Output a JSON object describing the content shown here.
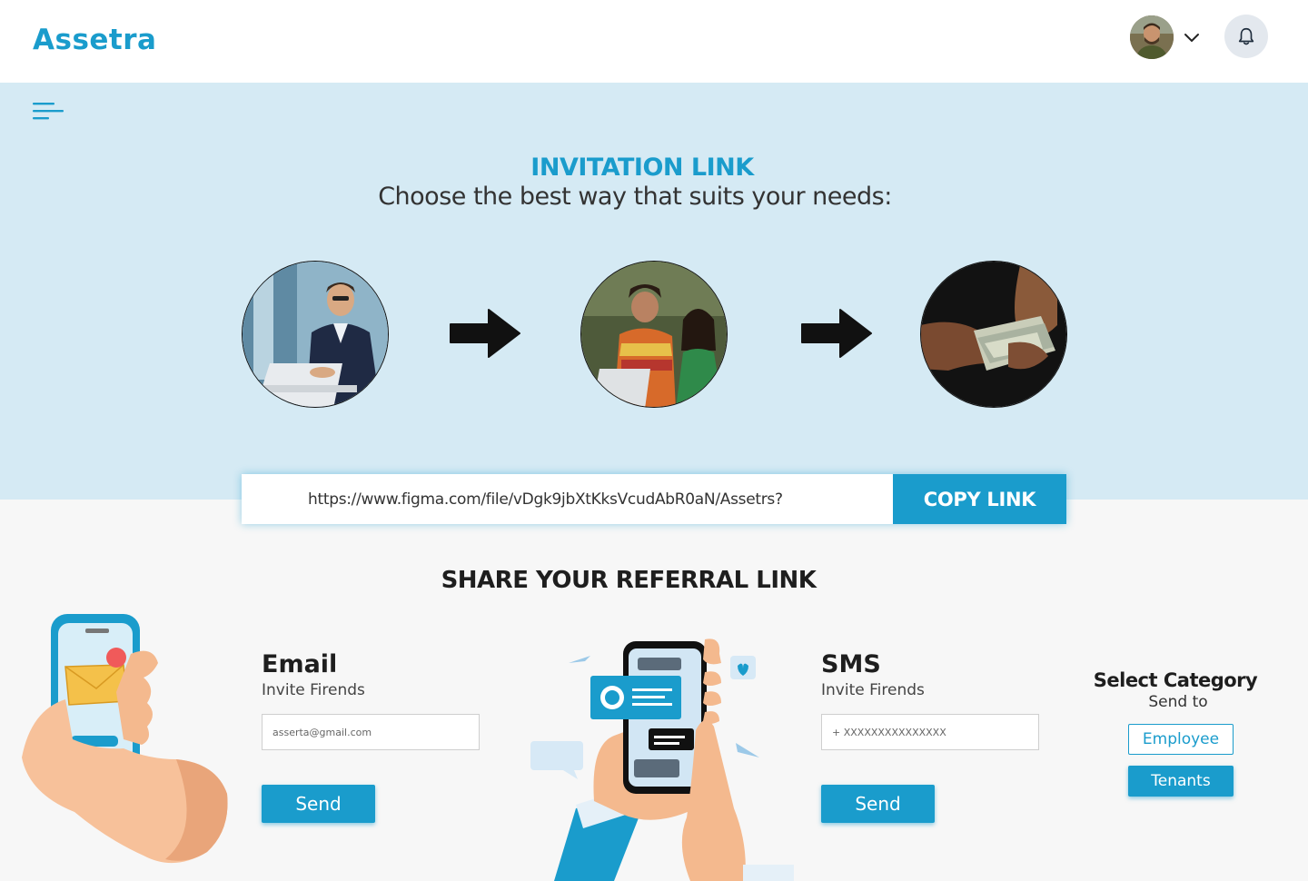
{
  "app": {
    "logo": "Assetra"
  },
  "header": {
    "avatar": "avatar",
    "dropdown_icon": "chevron-down-icon",
    "notification_icon": "bell-icon"
  },
  "hero": {
    "menu_icon": "menu-icon",
    "title": "INVITATION LINK",
    "subtitle": "Choose the best way that suits your needs:",
    "steps": [
      "man-working-on-laptop",
      "women-at-laptop",
      "hands-holding-cash"
    ],
    "step_arrow_icon": "arrow-right-icon"
  },
  "link": {
    "url": "https://www.figma.com/file/vDgk9jbXtKksVcudAbR0aN/Assetrs?",
    "copy_label": "COPY LINK"
  },
  "share": {
    "title": "SHARE YOUR REFERRAL LINK",
    "email": {
      "title": "Email",
      "subtitle": "Invite Firends",
      "placeholder": "asserta@gmail.com",
      "send_label": "Send"
    },
    "sms": {
      "title": "SMS",
      "subtitle": "Invite Firends",
      "placeholder": "+ XXXXXXXXXXXXXXX",
      "send_label": "Send"
    },
    "category": {
      "title": "Select Category",
      "subtitle": "Send to",
      "options": [
        "Employee",
        "Tenants"
      ],
      "selected": "Tenants"
    }
  },
  "colors": {
    "brand": "#1a9ccc",
    "hero_bg": "#d5eaf4",
    "page_bg": "#f7f7f7"
  }
}
